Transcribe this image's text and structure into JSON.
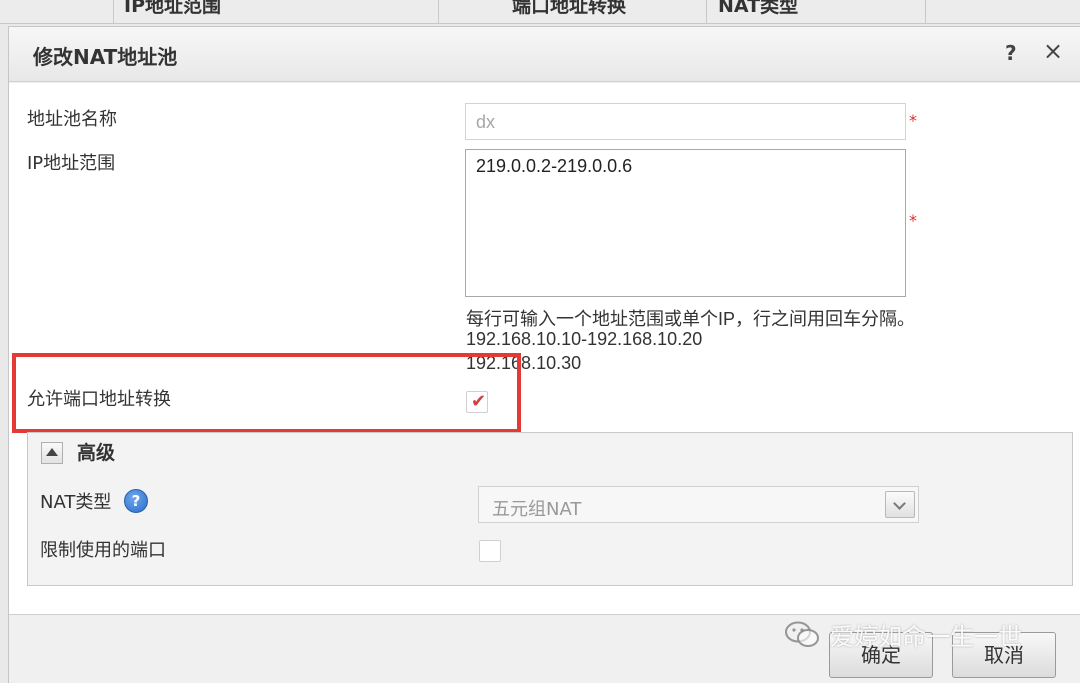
{
  "background_table": {
    "columns": [
      "IP地址范围",
      "端口地址转换",
      "NAT类型"
    ]
  },
  "dialog": {
    "title": "修改NAT地址池",
    "help_label": "?",
    "close_label": "×"
  },
  "form": {
    "pool_name": {
      "label": "地址池名称",
      "value": "dx",
      "required_mark": "*"
    },
    "ip_range": {
      "label": "IP地址范围",
      "value": "219.0.0.2-219.0.0.6",
      "required_mark": "*",
      "hint_lines": [
        "每行可输入一个地址范围或单个IP，行之间用回车分隔。",
        "192.168.10.10-192.168.10.20",
        "192.168.10.30"
      ]
    },
    "port_translation": {
      "label": "允许端口地址转换",
      "checked": true
    }
  },
  "advanced": {
    "title": "高级",
    "nat_type": {
      "label": "NAT类型",
      "help": "?",
      "value": "五元组NAT"
    },
    "limit_ports": {
      "label": "限制使用的端口",
      "checked": false
    }
  },
  "footer": {
    "ok_label": "确定",
    "cancel_label": "取消"
  },
  "watermark": {
    "text": "爱婷如命一生一世"
  },
  "colors": {
    "highlight": "#e53935",
    "required": "#d9342b",
    "help_blue": "#2a6cc4"
  }
}
